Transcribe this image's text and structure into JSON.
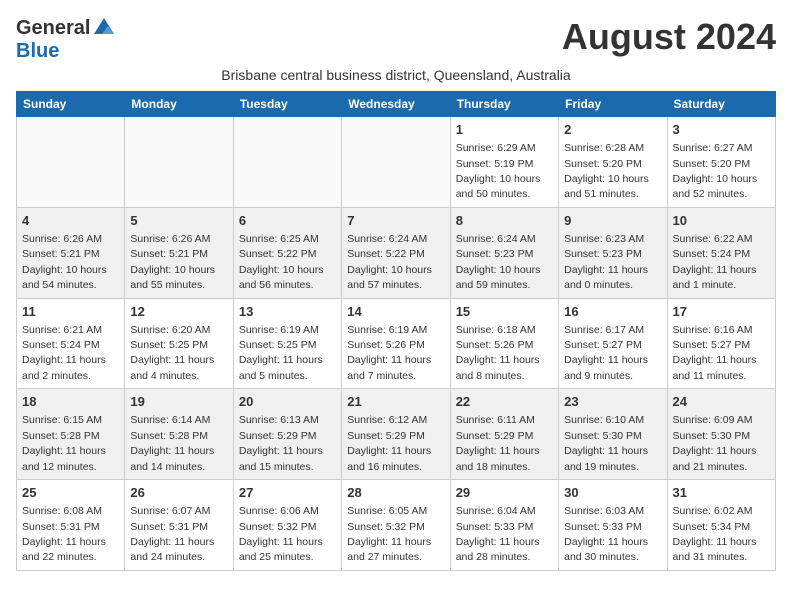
{
  "header": {
    "logo_general": "General",
    "logo_blue": "Blue",
    "month_title": "August 2024",
    "subtitle": "Brisbane central business district, Queensland, Australia"
  },
  "weekdays": [
    "Sunday",
    "Monday",
    "Tuesday",
    "Wednesday",
    "Thursday",
    "Friday",
    "Saturday"
  ],
  "weeks": [
    [
      {
        "day": "",
        "info": ""
      },
      {
        "day": "",
        "info": ""
      },
      {
        "day": "",
        "info": ""
      },
      {
        "day": "",
        "info": ""
      },
      {
        "day": "1",
        "info": "Sunrise: 6:29 AM\nSunset: 5:19 PM\nDaylight: 10 hours and 50 minutes."
      },
      {
        "day": "2",
        "info": "Sunrise: 6:28 AM\nSunset: 5:20 PM\nDaylight: 10 hours and 51 minutes."
      },
      {
        "day": "3",
        "info": "Sunrise: 6:27 AM\nSunset: 5:20 PM\nDaylight: 10 hours and 52 minutes."
      }
    ],
    [
      {
        "day": "4",
        "info": "Sunrise: 6:26 AM\nSunset: 5:21 PM\nDaylight: 10 hours and 54 minutes."
      },
      {
        "day": "5",
        "info": "Sunrise: 6:26 AM\nSunset: 5:21 PM\nDaylight: 10 hours and 55 minutes."
      },
      {
        "day": "6",
        "info": "Sunrise: 6:25 AM\nSunset: 5:22 PM\nDaylight: 10 hours and 56 minutes."
      },
      {
        "day": "7",
        "info": "Sunrise: 6:24 AM\nSunset: 5:22 PM\nDaylight: 10 hours and 57 minutes."
      },
      {
        "day": "8",
        "info": "Sunrise: 6:24 AM\nSunset: 5:23 PM\nDaylight: 10 hours and 59 minutes."
      },
      {
        "day": "9",
        "info": "Sunrise: 6:23 AM\nSunset: 5:23 PM\nDaylight: 11 hours and 0 minutes."
      },
      {
        "day": "10",
        "info": "Sunrise: 6:22 AM\nSunset: 5:24 PM\nDaylight: 11 hours and 1 minute."
      }
    ],
    [
      {
        "day": "11",
        "info": "Sunrise: 6:21 AM\nSunset: 5:24 PM\nDaylight: 11 hours and 2 minutes."
      },
      {
        "day": "12",
        "info": "Sunrise: 6:20 AM\nSunset: 5:25 PM\nDaylight: 11 hours and 4 minutes."
      },
      {
        "day": "13",
        "info": "Sunrise: 6:19 AM\nSunset: 5:25 PM\nDaylight: 11 hours and 5 minutes."
      },
      {
        "day": "14",
        "info": "Sunrise: 6:19 AM\nSunset: 5:26 PM\nDaylight: 11 hours and 7 minutes."
      },
      {
        "day": "15",
        "info": "Sunrise: 6:18 AM\nSunset: 5:26 PM\nDaylight: 11 hours and 8 minutes."
      },
      {
        "day": "16",
        "info": "Sunrise: 6:17 AM\nSunset: 5:27 PM\nDaylight: 11 hours and 9 minutes."
      },
      {
        "day": "17",
        "info": "Sunrise: 6:16 AM\nSunset: 5:27 PM\nDaylight: 11 hours and 11 minutes."
      }
    ],
    [
      {
        "day": "18",
        "info": "Sunrise: 6:15 AM\nSunset: 5:28 PM\nDaylight: 11 hours and 12 minutes."
      },
      {
        "day": "19",
        "info": "Sunrise: 6:14 AM\nSunset: 5:28 PM\nDaylight: 11 hours and 14 minutes."
      },
      {
        "day": "20",
        "info": "Sunrise: 6:13 AM\nSunset: 5:29 PM\nDaylight: 11 hours and 15 minutes."
      },
      {
        "day": "21",
        "info": "Sunrise: 6:12 AM\nSunset: 5:29 PM\nDaylight: 11 hours and 16 minutes."
      },
      {
        "day": "22",
        "info": "Sunrise: 6:11 AM\nSunset: 5:29 PM\nDaylight: 11 hours and 18 minutes."
      },
      {
        "day": "23",
        "info": "Sunrise: 6:10 AM\nSunset: 5:30 PM\nDaylight: 11 hours and 19 minutes."
      },
      {
        "day": "24",
        "info": "Sunrise: 6:09 AM\nSunset: 5:30 PM\nDaylight: 11 hours and 21 minutes."
      }
    ],
    [
      {
        "day": "25",
        "info": "Sunrise: 6:08 AM\nSunset: 5:31 PM\nDaylight: 11 hours and 22 minutes."
      },
      {
        "day": "26",
        "info": "Sunrise: 6:07 AM\nSunset: 5:31 PM\nDaylight: 11 hours and 24 minutes."
      },
      {
        "day": "27",
        "info": "Sunrise: 6:06 AM\nSunset: 5:32 PM\nDaylight: 11 hours and 25 minutes."
      },
      {
        "day": "28",
        "info": "Sunrise: 6:05 AM\nSunset: 5:32 PM\nDaylight: 11 hours and 27 minutes."
      },
      {
        "day": "29",
        "info": "Sunrise: 6:04 AM\nSunset: 5:33 PM\nDaylight: 11 hours and 28 minutes."
      },
      {
        "day": "30",
        "info": "Sunrise: 6:03 AM\nSunset: 5:33 PM\nDaylight: 11 hours and 30 minutes."
      },
      {
        "day": "31",
        "info": "Sunrise: 6:02 AM\nSunset: 5:34 PM\nDaylight: 11 hours and 31 minutes."
      }
    ]
  ]
}
